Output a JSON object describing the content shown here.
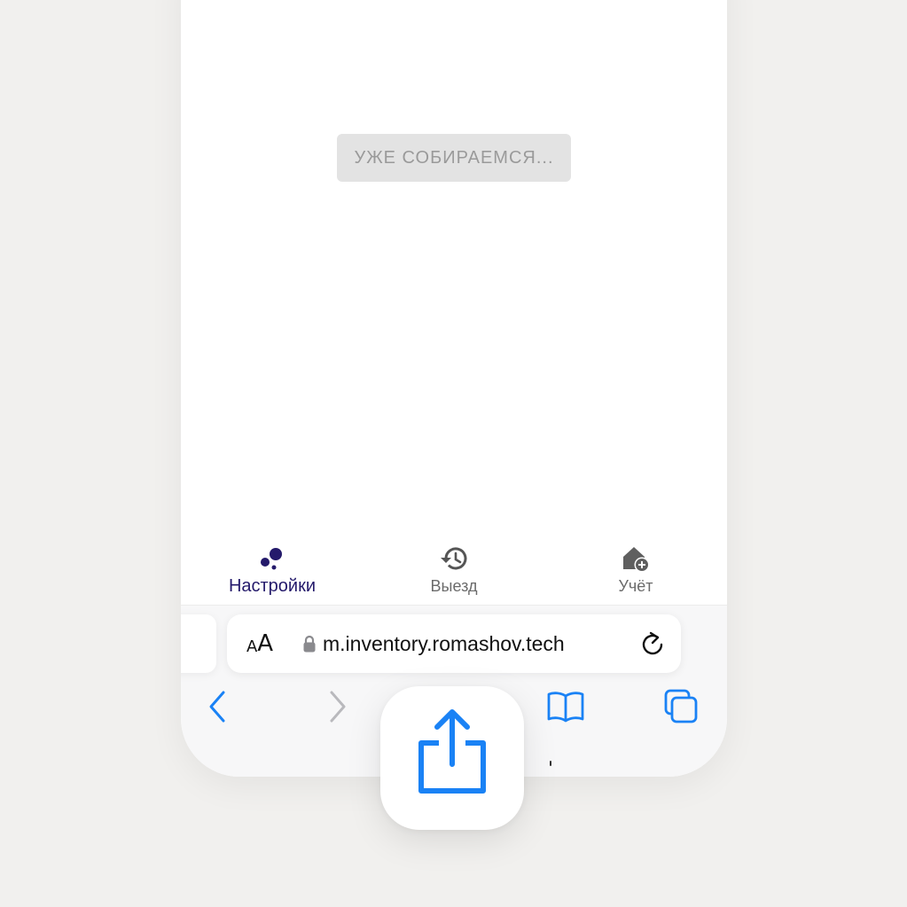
{
  "app": {
    "status_button_label": "УЖЕ СОБИРАЕМСЯ..."
  },
  "bottom_nav": {
    "items": [
      {
        "label": "Настройки",
        "icon": "dots-icon",
        "active": true
      },
      {
        "label": "Выезд",
        "icon": "history-icon",
        "active": false
      },
      {
        "label": "Учёт",
        "icon": "add-home-icon",
        "active": false
      }
    ]
  },
  "browser": {
    "text_size_small": "A",
    "text_size_large": "A",
    "url": "m.inventory.romashov.tech",
    "secure_icon": "lock-icon",
    "reload_icon": "reload-icon",
    "toolbar": [
      "back-icon",
      "forward-icon",
      "share-icon",
      "bookmarks-icon",
      "tabs-icon"
    ]
  },
  "colors": {
    "accent_blue": "#1a82f5",
    "active_nav": "#241a6b",
    "inactive_nav": "#6b6b6b",
    "disabled_button_bg": "#e3e3e3",
    "disabled_button_text": "#9a9a9a",
    "background": "#f1f0ee"
  }
}
